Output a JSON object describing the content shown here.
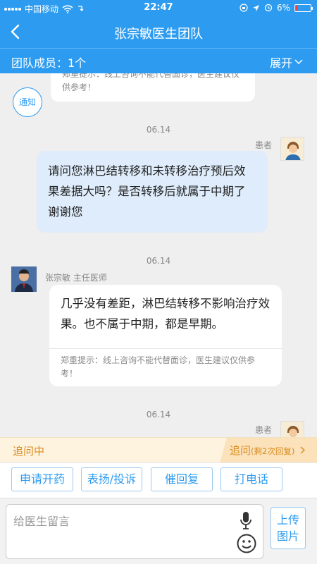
{
  "status_bar": {
    "carrier": "中国移动",
    "time": "22:47",
    "battery": "6%"
  },
  "nav": {
    "title": "张宗敏医生团队"
  },
  "team": {
    "members": "团队成员：1个",
    "expand": "展开"
  },
  "chat": {
    "top_tip": "郑重提示：线上咨询不能代替面诊，医生建议仅供参考！",
    "notify_label": "通知",
    "date1": "06.14",
    "patient_label": "患者",
    "patient_msg": "请问您淋巴结转移和未转移治疗预后效果差据大吗？是否转移后就属于中期了 谢谢您",
    "date2": "06.14",
    "doctor_name": "张宗敏 主任医师",
    "doctor_msg": "几乎没有差距，淋巴结转移不影响治疗效果。也不属于中期，都是早期。",
    "doctor_tip": "郑重提示：线上咨询不能代替面诊，医生建议仅供参考！",
    "date3": "06.14",
    "patient_label2": "患者"
  },
  "follow_bar": {
    "status": "追问中",
    "follow_label": "追问",
    "remaining": "(剩2次回复)"
  },
  "actions": {
    "prescribe": "申请开药",
    "praise": "表扬/投诉",
    "urge": "催回复",
    "call": "打电话"
  },
  "input": {
    "placeholder": "给医生留言",
    "upload_line1": "上传",
    "upload_line2": "图片"
  },
  "colors": {
    "primary": "#2d9cf0",
    "patient_bubble": "#deecfb",
    "follow_orange": "#d98c1e"
  }
}
